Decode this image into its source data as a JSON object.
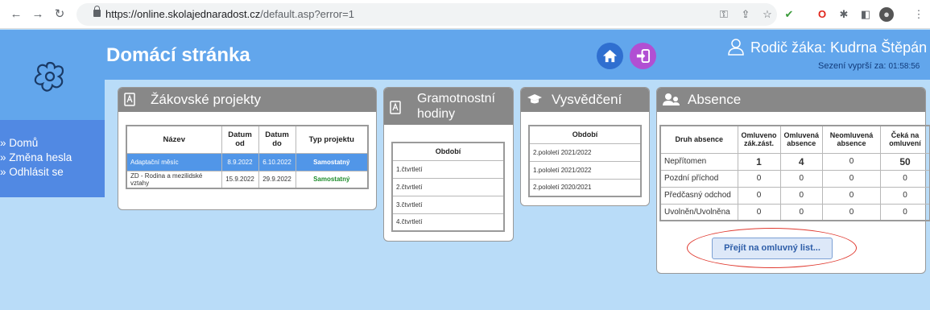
{
  "browser": {
    "url_host": "https://online.skolajednaradost.cz",
    "url_path": "/default.asp?error=1"
  },
  "header": {
    "title": "Domácí stránka",
    "user_label": "Rodič žáka: Kudrna Štěpán",
    "session_label": "Sezení vyprší za:",
    "session_time": "01:58:56"
  },
  "sidebar": {
    "items": [
      {
        "label": "» Domů"
      },
      {
        "label": "» Změna hesla"
      },
      {
        "label": "» Odhlásit se"
      }
    ]
  },
  "projects": {
    "title": "Žákovské projekty",
    "columns": [
      "Název",
      "Datum od",
      "Datum do",
      "Typ projektu"
    ],
    "rows": [
      {
        "name": "Adaptační měsíc",
        "from": "8.9.2022",
        "to": "6.10.2022",
        "type": "Samostatný",
        "selected": true
      },
      {
        "name": "ZD - Rodina a mezilidské vztahy",
        "from": "15.9.2022",
        "to": "29.9.2022",
        "type": "Samostatný",
        "selected": false
      }
    ]
  },
  "gramotnost": {
    "title": "Gramotnostní hodiny",
    "column": "Období",
    "rows": [
      "1.čtvrtletí",
      "2.čtvrtletí",
      "3.čtvrtletí",
      "4.čtvrtletí"
    ]
  },
  "vysvedceni": {
    "title": "Vysvědčení",
    "column": "Období",
    "rows": [
      "2.pololetí 2021/2022",
      "1.pololetí 2021/2022",
      "2.pololetí 2020/2021"
    ]
  },
  "absence": {
    "title": "Absence",
    "columns": [
      "Druh absence",
      "Omluveno zák.zást.",
      "Omluvená absence",
      "Neomluvená absence",
      "Čeká na omluvení"
    ],
    "rows": [
      {
        "kind": "Nepřítomen",
        "values": [
          "1",
          "4",
          "0",
          "50"
        ]
      },
      {
        "kind": "Pozdní příchod",
        "values": [
          "0",
          "0",
          "0",
          "0"
        ]
      },
      {
        "kind": "Předčasný odchod",
        "values": [
          "0",
          "0",
          "0",
          "0"
        ]
      },
      {
        "kind": "Uvolněn/Uvolněna",
        "values": [
          "0",
          "0",
          "0",
          "0"
        ]
      }
    ],
    "button_label": "Přejít na omluvný list..."
  },
  "colors": {
    "header_blue": "#62a6ec",
    "menu_blue": "#5189e3",
    "content_bg": "#b9dcf8",
    "annotation_red": "#e03a30"
  }
}
